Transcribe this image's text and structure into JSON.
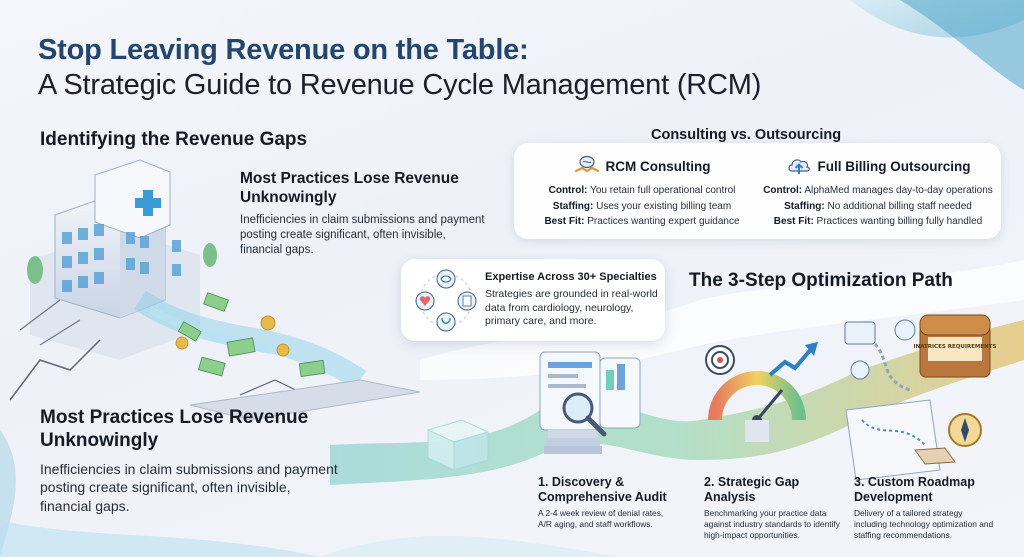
{
  "title": {
    "line1": "Stop Leaving Revenue on the Table:",
    "line2": "A Strategic Guide to Revenue Cycle Management (RCM)"
  },
  "gaps": {
    "heading": "Identifying the Revenue Gaps",
    "top_heading": "Most Practices Lose Revenue Unknowingly",
    "top_body": "Inefficiencies in claim submissions and payment posting create significant, often invisible, financial gaps.",
    "bottom_heading": "Most Practices Lose Revenue Unknowingly",
    "bottom_body": "Inefficiencies in claim submissions and payment posting create significant, often invisible, financial gaps."
  },
  "comparison": {
    "title": "Consulting vs. Outsourcing",
    "consulting": {
      "label": "RCM Consulting",
      "icon": "handshake-brain-icon",
      "rows": [
        {
          "key": "Control:",
          "value": " You retain full operational control"
        },
        {
          "key": "Staffing:",
          "value": " Uses your existing billing team"
        },
        {
          "key": "Best Fit:",
          "value": " Practices wanting expert guidance"
        }
      ]
    },
    "outsourcing": {
      "label": "Full Billing Outsourcing",
      "icon": "cloud-upload-icon",
      "rows": [
        {
          "key": "Control:",
          "value": " AlphaMed manages day-to-day operations"
        },
        {
          "key": "Staffing:",
          "value": " No additional billing staff needed"
        },
        {
          "key": "Best Fit:",
          "value": " Practices wanting billing fully handled"
        }
      ]
    }
  },
  "specialties": {
    "title": "Expertise Across 30+ Specialties",
    "body": "Strategies are grounded in real-world data from cardiology, neurology, primary care, and more."
  },
  "path": {
    "title": "The 3-Step Optimization Path",
    "steps": [
      {
        "title": "1. Discovery & Comprehensive Audit",
        "desc": "A 2-4 week review of denial rates, A/R aging, and staff workflows."
      },
      {
        "title": "2. Strategic Gap Analysis",
        "desc": "Benchmarking your practice data against industry standards to identify high-impact opportunities."
      },
      {
        "title": "3. Custom Roadmap Development",
        "desc": "Delivery of a tailored strategy including technology optimization and staffing recommendations."
      }
    ]
  },
  "chest_label": "INATRICES REQUIREMENTS",
  "colors": {
    "title_blue": "#23466e",
    "teal": "#6ec9c4",
    "gold": "#d9a441",
    "navy_text": "#151a24"
  }
}
